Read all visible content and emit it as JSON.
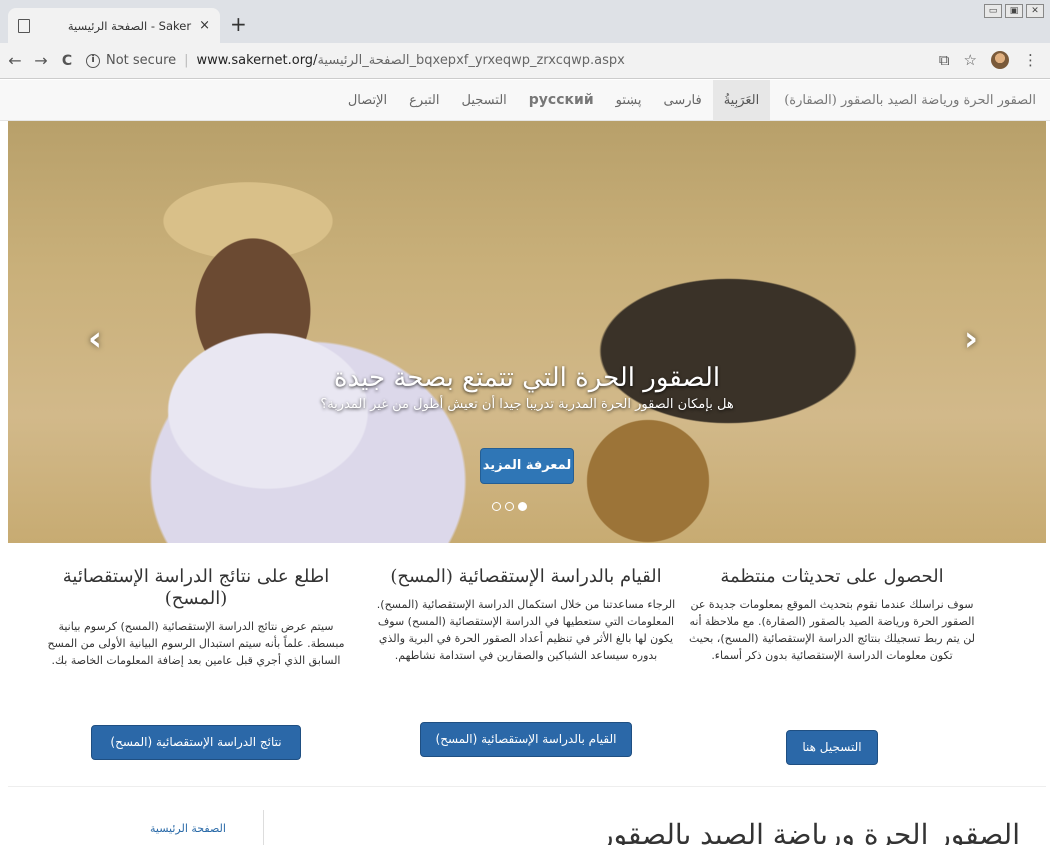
{
  "browser": {
    "tab_title": "الصفحة الرئيسية - Saker",
    "tab_close": "×",
    "new_tab": "+",
    "window_controls": [
      "▭",
      "▣",
      "✕"
    ],
    "back": "←",
    "forward": "→",
    "reload": "C",
    "info": "i",
    "not_secure": "Not secure",
    "separator": "|",
    "url_host": "www.sakernet.org/",
    "url_path": "الصفحة_الرئيسية_bqxepxf_yrxeqwp_zrxcqwp.aspx",
    "translate_icon": "⧉",
    "star_icon": "☆",
    "menu_icon": "⋮"
  },
  "site_nav": {
    "brand": "الصقور الحرة ورياضة الصيد بالصقور (الصقارة)",
    "items": [
      "العَرَبِيةُ",
      "فارسی",
      "پښتو",
      "русский",
      "التسجيل",
      "التبرع",
      "الإتصال"
    ]
  },
  "hero": {
    "heading": "الصقور الحرة التي تتمتع بصحة جيدة",
    "subheading": "هل بإمكان الصقور الحرة المدربة تدريبا جيدا أن تعيش أطول من غير المدربة؟",
    "cta": "لمعرفة المزيد",
    "prev": "‹",
    "next": "›"
  },
  "columns": [
    {
      "title": "الحصول على تحديثات منتظمة",
      "body": "سوف نراسلك عندما نقوم بتحديث الموقع بمعلومات جديدة عن الصقور الحرة ورياضة الصيد بالصقور (الصقارة). مع ملاحظة أنه لن يتم ربط تسجيلك بنتائج الدراسة الإستقصائية (المسح)، بحيث تكون معلومات الدراسة الإستقصائية بدون ذكر أسماء.",
      "button": "التسجيل هنا"
    },
    {
      "title": "القيام بالدراسة الإستقصائية (المسح)",
      "body": "الرجاء مساعدتنا من خلال استكمال الدراسة الإستقصائية (المسح). المعلومات التي ستعطيها في الدراسة الإستقصائية (المسح) سوف يكون لها بالغ الأثر في تنظيم أعداد الصقور الحرة في البرية والذي بدوره سيساعد الشباكين والصقارين في استدامة نشاطهم.",
      "button": "القيام بالدراسة الإستقصائية (المسح)"
    },
    {
      "title": "اطلع على نتائج الدراسة الإستقصائية (المسح)",
      "body": "سيتم عرض نتائج الدراسة الإستقصائية (المسح) كرسوم بيانية مبسطة. علماً بأنه سيتم استبدال الرسوم البيانية الأولى من المسح السابق الذي أجري قبل عامين بعد إضافة المعلومات الخاصة بك.",
      "button": "نتائج الدراسة الإستقصائية (المسح)"
    }
  ],
  "footer": {
    "home_link": "الصفحة الرئيسية",
    "section_title": "الصقور الحرة ورياضة الصيد بالصقور"
  }
}
